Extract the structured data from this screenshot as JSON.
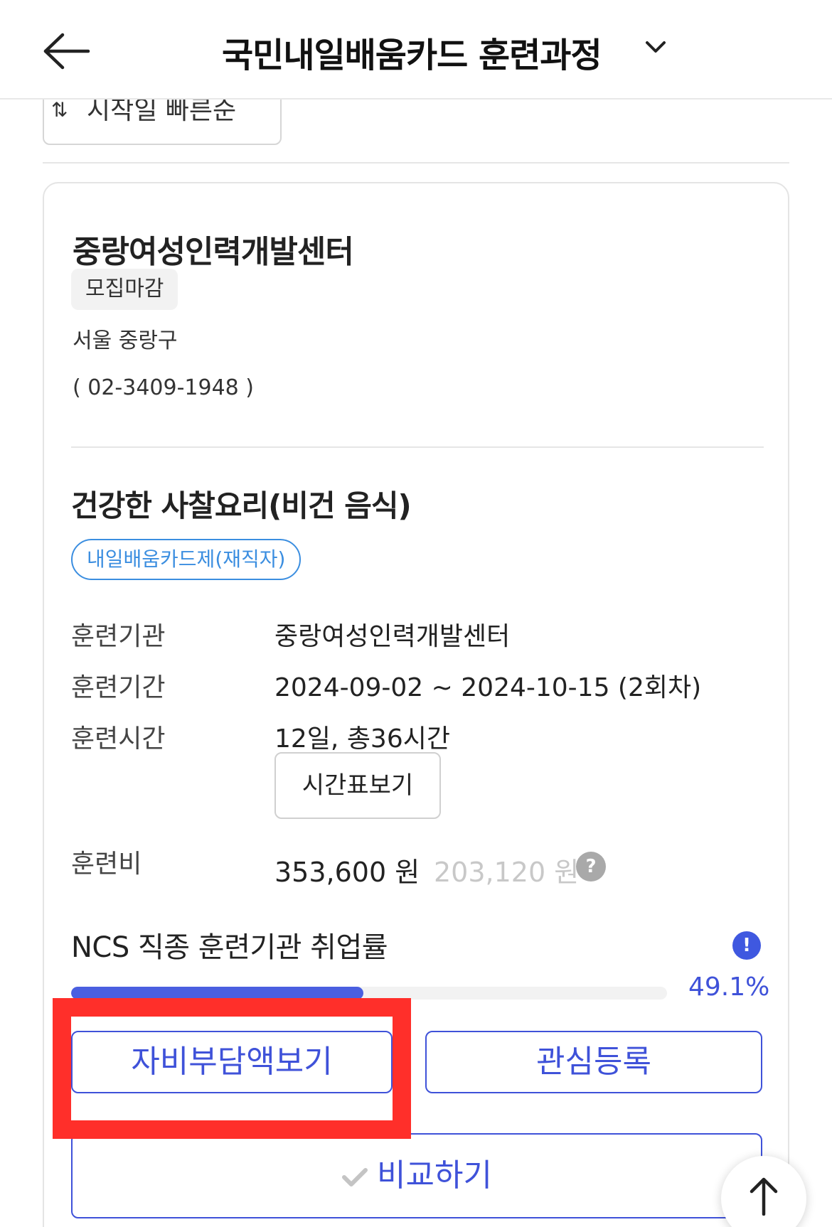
{
  "header": {
    "title": "국민내일배움카드 훈련과정"
  },
  "sort": {
    "label": "시작일 빠른순"
  },
  "organization": {
    "name": "중랑여성인력개발센터",
    "status": "모집마감",
    "location": "서울 중랑구",
    "phone": "( 02-3409-1948 )"
  },
  "course": {
    "title": "건강한 사찰요리(비건 음식)",
    "tag": "내일배움카드제(재직자)",
    "rows": {
      "institution_label": "훈련기관",
      "institution_value": "중랑여성인력개발센터",
      "period_label": "훈련기간",
      "period_value": "2024-09-02 ~ 2024-10-15 (2회차)",
      "hours_label": "훈련시간",
      "hours_value": "12일, 총36시간",
      "fee_label": "훈련비"
    },
    "timetable_button": "시간표보기",
    "fee_price": "353,600 원",
    "fee_discount": "203,120 원",
    "help_glyph": "?"
  },
  "ncs": {
    "title": "NCS 직종 훈련기관 취업률",
    "info_glyph": "!",
    "employment_rate_percent": 49.1,
    "employment_rate_label": "49.1%"
  },
  "actions": {
    "self_pay_button": "자비부담액보기",
    "interest_button": "관심등록",
    "compare_button": "비교하기"
  },
  "colors": {
    "accent": "#3f52d9",
    "tag_blue": "#3b8ee0",
    "highlight_red": "#ff2f2a",
    "progress_fill": "#4a5fe0"
  },
  "icons": {
    "back": "arrow-left-icon",
    "dropdown": "chevron-down-icon",
    "sort": "sort-icon",
    "help": "question-circle-icon",
    "info": "exclamation-circle-icon",
    "check": "check-icon",
    "scroll_top": "arrow-up-icon"
  }
}
